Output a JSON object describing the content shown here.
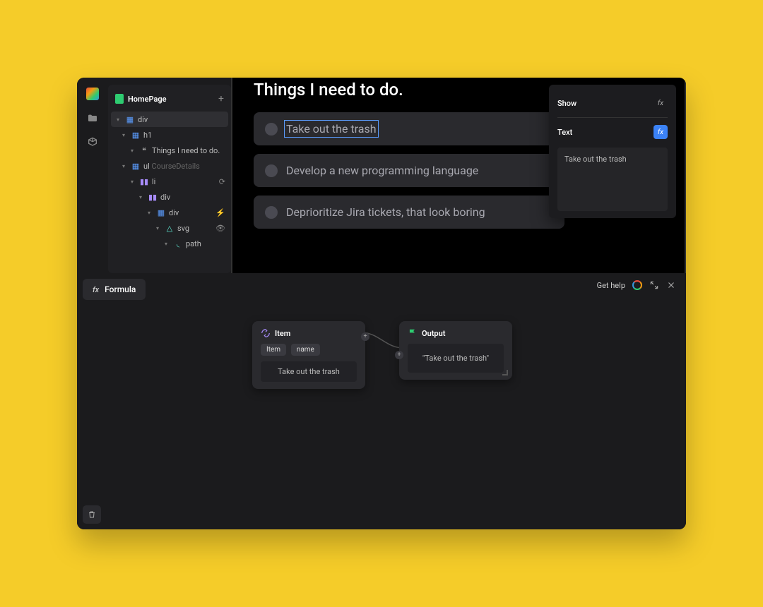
{
  "sidebar": {
    "title": "HomePage",
    "tree": [
      {
        "label": "div",
        "indent": 0,
        "icon": "box",
        "color": "t-blue",
        "sel": true
      },
      {
        "label": "h1",
        "indent": 1,
        "icon": "box",
        "color": "t-blue"
      },
      {
        "label": "Things I need to do.",
        "indent": 2,
        "icon": "quote",
        "color": "t-gray"
      },
      {
        "label": "ul",
        "suffix": "CourseDetails",
        "indent": 1,
        "icon": "box",
        "color": "t-blue"
      },
      {
        "label": "li",
        "indent": 2,
        "icon": "bars",
        "color": "t-purple",
        "action": "loop"
      },
      {
        "label": "div",
        "indent": 3,
        "icon": "bars",
        "color": "t-purple"
      },
      {
        "label": "div",
        "indent": 4,
        "icon": "box",
        "color": "t-blue",
        "action": "bolt"
      },
      {
        "label": "svg",
        "indent": 5,
        "icon": "tri",
        "color": "t-teal",
        "action": "eye"
      },
      {
        "label": "path",
        "indent": 6,
        "icon": "curve",
        "color": "t-teal"
      }
    ]
  },
  "preview": {
    "title": "Things I need to do.",
    "tasks": [
      {
        "text": "Take out the trash",
        "sel": true
      },
      {
        "text": "Develop a new programming language"
      },
      {
        "text": "Deprioritize Jira tickets, that look boring"
      }
    ]
  },
  "props": {
    "show_label": "Show",
    "text_label": "Text",
    "value": "Take out the trash"
  },
  "formula": {
    "tab": "Formula",
    "help": "Get help",
    "item_node": {
      "title": "Item",
      "chip1": "Item",
      "chip2": "name",
      "value": "Take out the trash"
    },
    "output_node": {
      "title": "Output",
      "value": "\"Take out the trash\""
    }
  }
}
